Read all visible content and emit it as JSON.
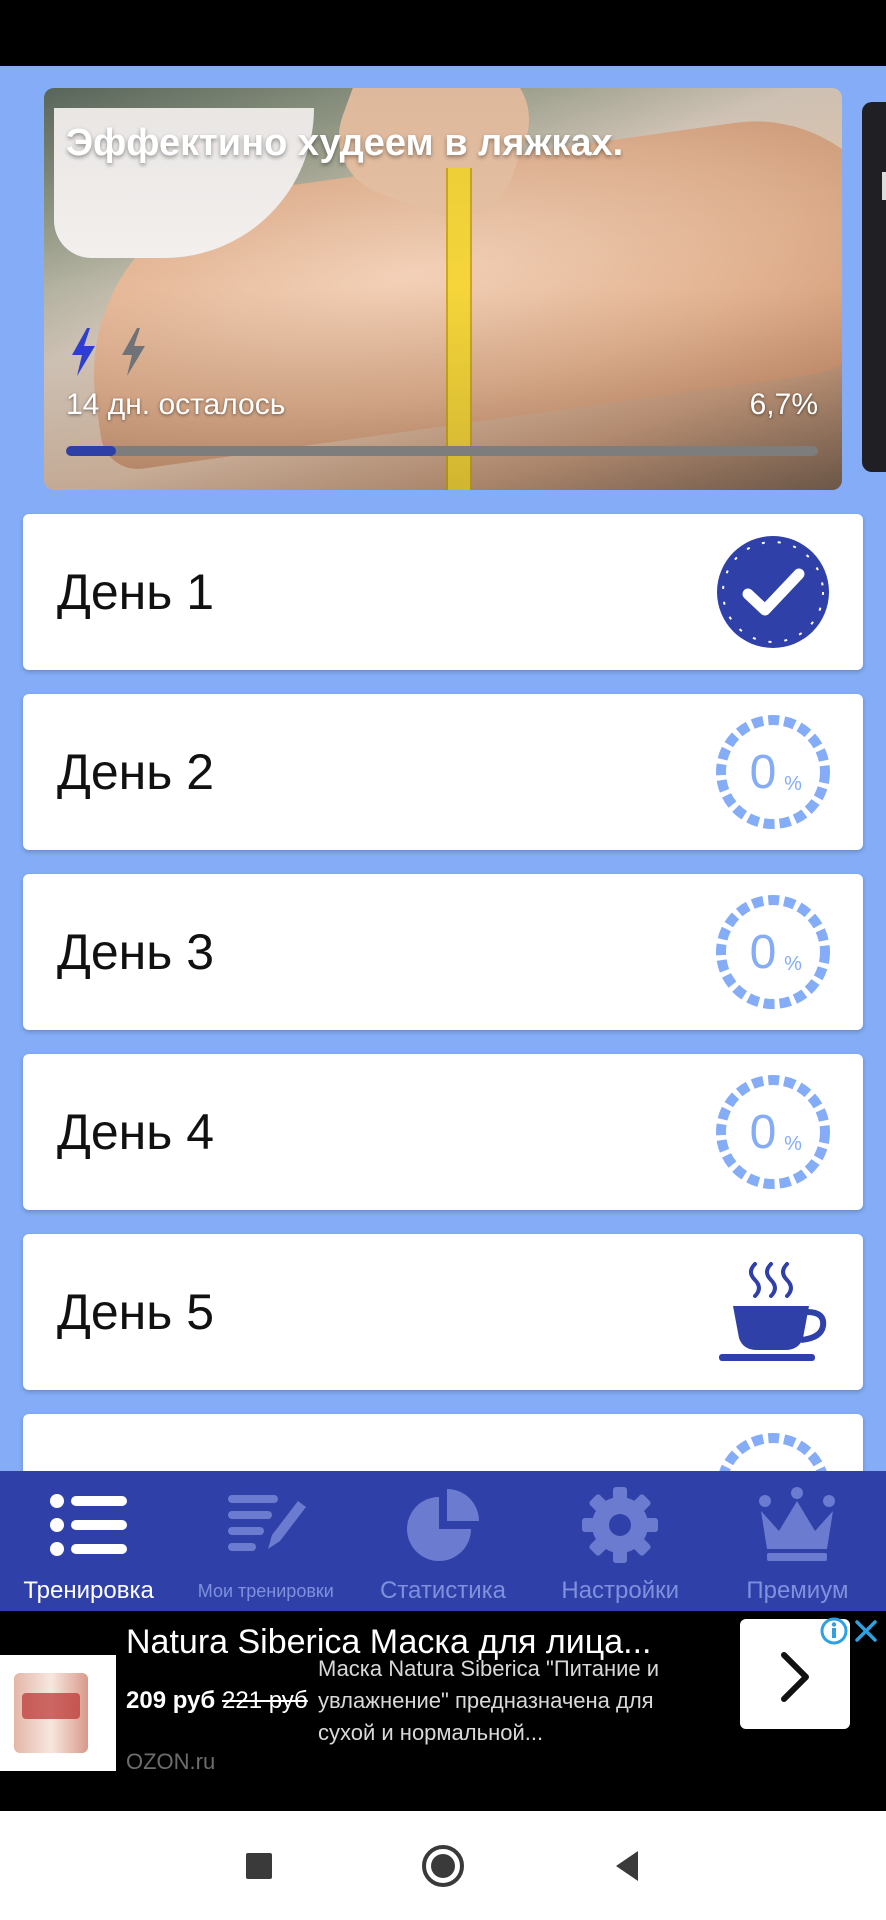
{
  "hero": {
    "title": "Эффектино худеем в ляжках.",
    "remaining": "14 дн. осталось",
    "percent": "6,7%",
    "progress": 0.067,
    "image_icon": "thigh-measuring-tape-photo",
    "level_icons": [
      "lightning-bolt-icon-filled",
      "lightning-bolt-icon-empty"
    ]
  },
  "days": [
    {
      "label": "День 1",
      "status": "completed",
      "icon": "check-badge-icon"
    },
    {
      "label": "День 2",
      "status": "progress",
      "percent_value": "0",
      "percent_sign": "%"
    },
    {
      "label": "День 3",
      "status": "progress",
      "percent_value": "0",
      "percent_sign": "%"
    },
    {
      "label": "День 4",
      "status": "progress",
      "percent_value": "0",
      "percent_sign": "%"
    },
    {
      "label": "День 5",
      "status": "rest",
      "icon": "coffee-cup-icon"
    }
  ],
  "nav": {
    "items": [
      {
        "label": "Тренировка",
        "icon": "list-icon",
        "active": true
      },
      {
        "label": "Мои тренировки",
        "icon": "notes-edit-icon",
        "active": false
      },
      {
        "label": "Статистика",
        "icon": "pie-chart-icon",
        "active": false
      },
      {
        "label": "Настройки",
        "icon": "gear-icon",
        "active": false
      },
      {
        "label": "Премиум",
        "icon": "crown-icon",
        "active": false
      }
    ]
  },
  "ad": {
    "title": "Natura Siberica Маска для лица...",
    "price": "209 руб",
    "old_price": "221 руб",
    "description": "Маска Natura Siberica \"Питание и увлажнение\" предназначена для сухой и нормальной...",
    "source": "OZON.ru"
  },
  "colors": {
    "background": "#84acf7",
    "accent": "#2f40a8",
    "progress_ring": "#84acf7",
    "nav_inactive": "#7f90dc"
  }
}
